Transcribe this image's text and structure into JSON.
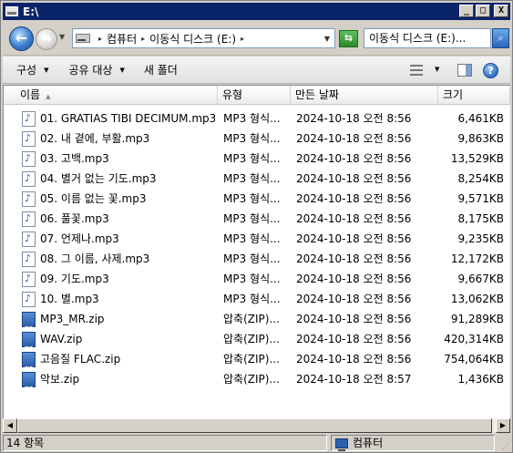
{
  "window": {
    "title": "E:\\",
    "buttons": {
      "minimize": "_",
      "maximize": "□",
      "close": "X"
    }
  },
  "address": {
    "crumbs": [
      "컴퓨터",
      "이동식 디스크 (E:)"
    ],
    "search_placeholder": "이동식 디스크 (E:)..."
  },
  "toolbar": {
    "organize": "구성",
    "share": "공유 대상",
    "new_folder": "새 폴더"
  },
  "columns": {
    "name": "이름",
    "type": "유형",
    "date": "만든 날짜",
    "size": "크기"
  },
  "files": [
    {
      "name": "01. GRATIAS TIBI DECIMUM.mp3",
      "type": "MP3 형식...",
      "date": "2024-10-18 오전 8:56",
      "size": "6,461KB",
      "icon": "mp3-icon"
    },
    {
      "name": "02. 내 곁에, 부활.mp3",
      "type": "MP3 형식...",
      "date": "2024-10-18 오전 8:56",
      "size": "9,863KB",
      "icon": "mp3-icon"
    },
    {
      "name": "03. 고백.mp3",
      "type": "MP3 형식...",
      "date": "2024-10-18 오전 8:56",
      "size": "13,529KB",
      "icon": "mp3-icon"
    },
    {
      "name": "04. 별거 없는 기도.mp3",
      "type": "MP3 형식...",
      "date": "2024-10-18 오전 8:56",
      "size": "8,254KB",
      "icon": "mp3-icon"
    },
    {
      "name": "05. 이름 없는 꽃.mp3",
      "type": "MP3 형식...",
      "date": "2024-10-18 오전 8:56",
      "size": "9,571KB",
      "icon": "mp3-icon"
    },
    {
      "name": "06. 풀꽃.mp3",
      "type": "MP3 형식...",
      "date": "2024-10-18 오전 8:56",
      "size": "8,175KB",
      "icon": "mp3-icon"
    },
    {
      "name": "07. 언제나.mp3",
      "type": "MP3 형식...",
      "date": "2024-10-18 오전 8:56",
      "size": "9,235KB",
      "icon": "mp3-icon"
    },
    {
      "name": "08. 그 이름, 사제.mp3",
      "type": "MP3 형식...",
      "date": "2024-10-18 오전 8:56",
      "size": "12,172KB",
      "icon": "mp3-icon"
    },
    {
      "name": "09. 기도.mp3",
      "type": "MP3 형식...",
      "date": "2024-10-18 오전 8:56",
      "size": "9,667KB",
      "icon": "mp3-icon"
    },
    {
      "name": "10. 별.mp3",
      "type": "MP3 형식...",
      "date": "2024-10-18 오전 8:56",
      "size": "13,062KB",
      "icon": "mp3-icon"
    },
    {
      "name": "MP3_MR.zip",
      "type": "압축(ZIP)...",
      "date": "2024-10-18 오전 8:56",
      "size": "91,289KB",
      "icon": "zip-icon"
    },
    {
      "name": "WAV.zip",
      "type": "압축(ZIP)...",
      "date": "2024-10-18 오전 8:56",
      "size": "420,314KB",
      "icon": "zip-icon"
    },
    {
      "name": "고음질 FLAC.zip",
      "type": "압축(ZIP)...",
      "date": "2024-10-18 오전 8:56",
      "size": "754,064KB",
      "icon": "zip-icon"
    },
    {
      "name": "악보.zip",
      "type": "압축(ZIP)...",
      "date": "2024-10-18 오전 8:57",
      "size": "1,436KB",
      "icon": "zip-icon"
    }
  ],
  "status": {
    "count": "14 항목",
    "location": "컴퓨터"
  }
}
